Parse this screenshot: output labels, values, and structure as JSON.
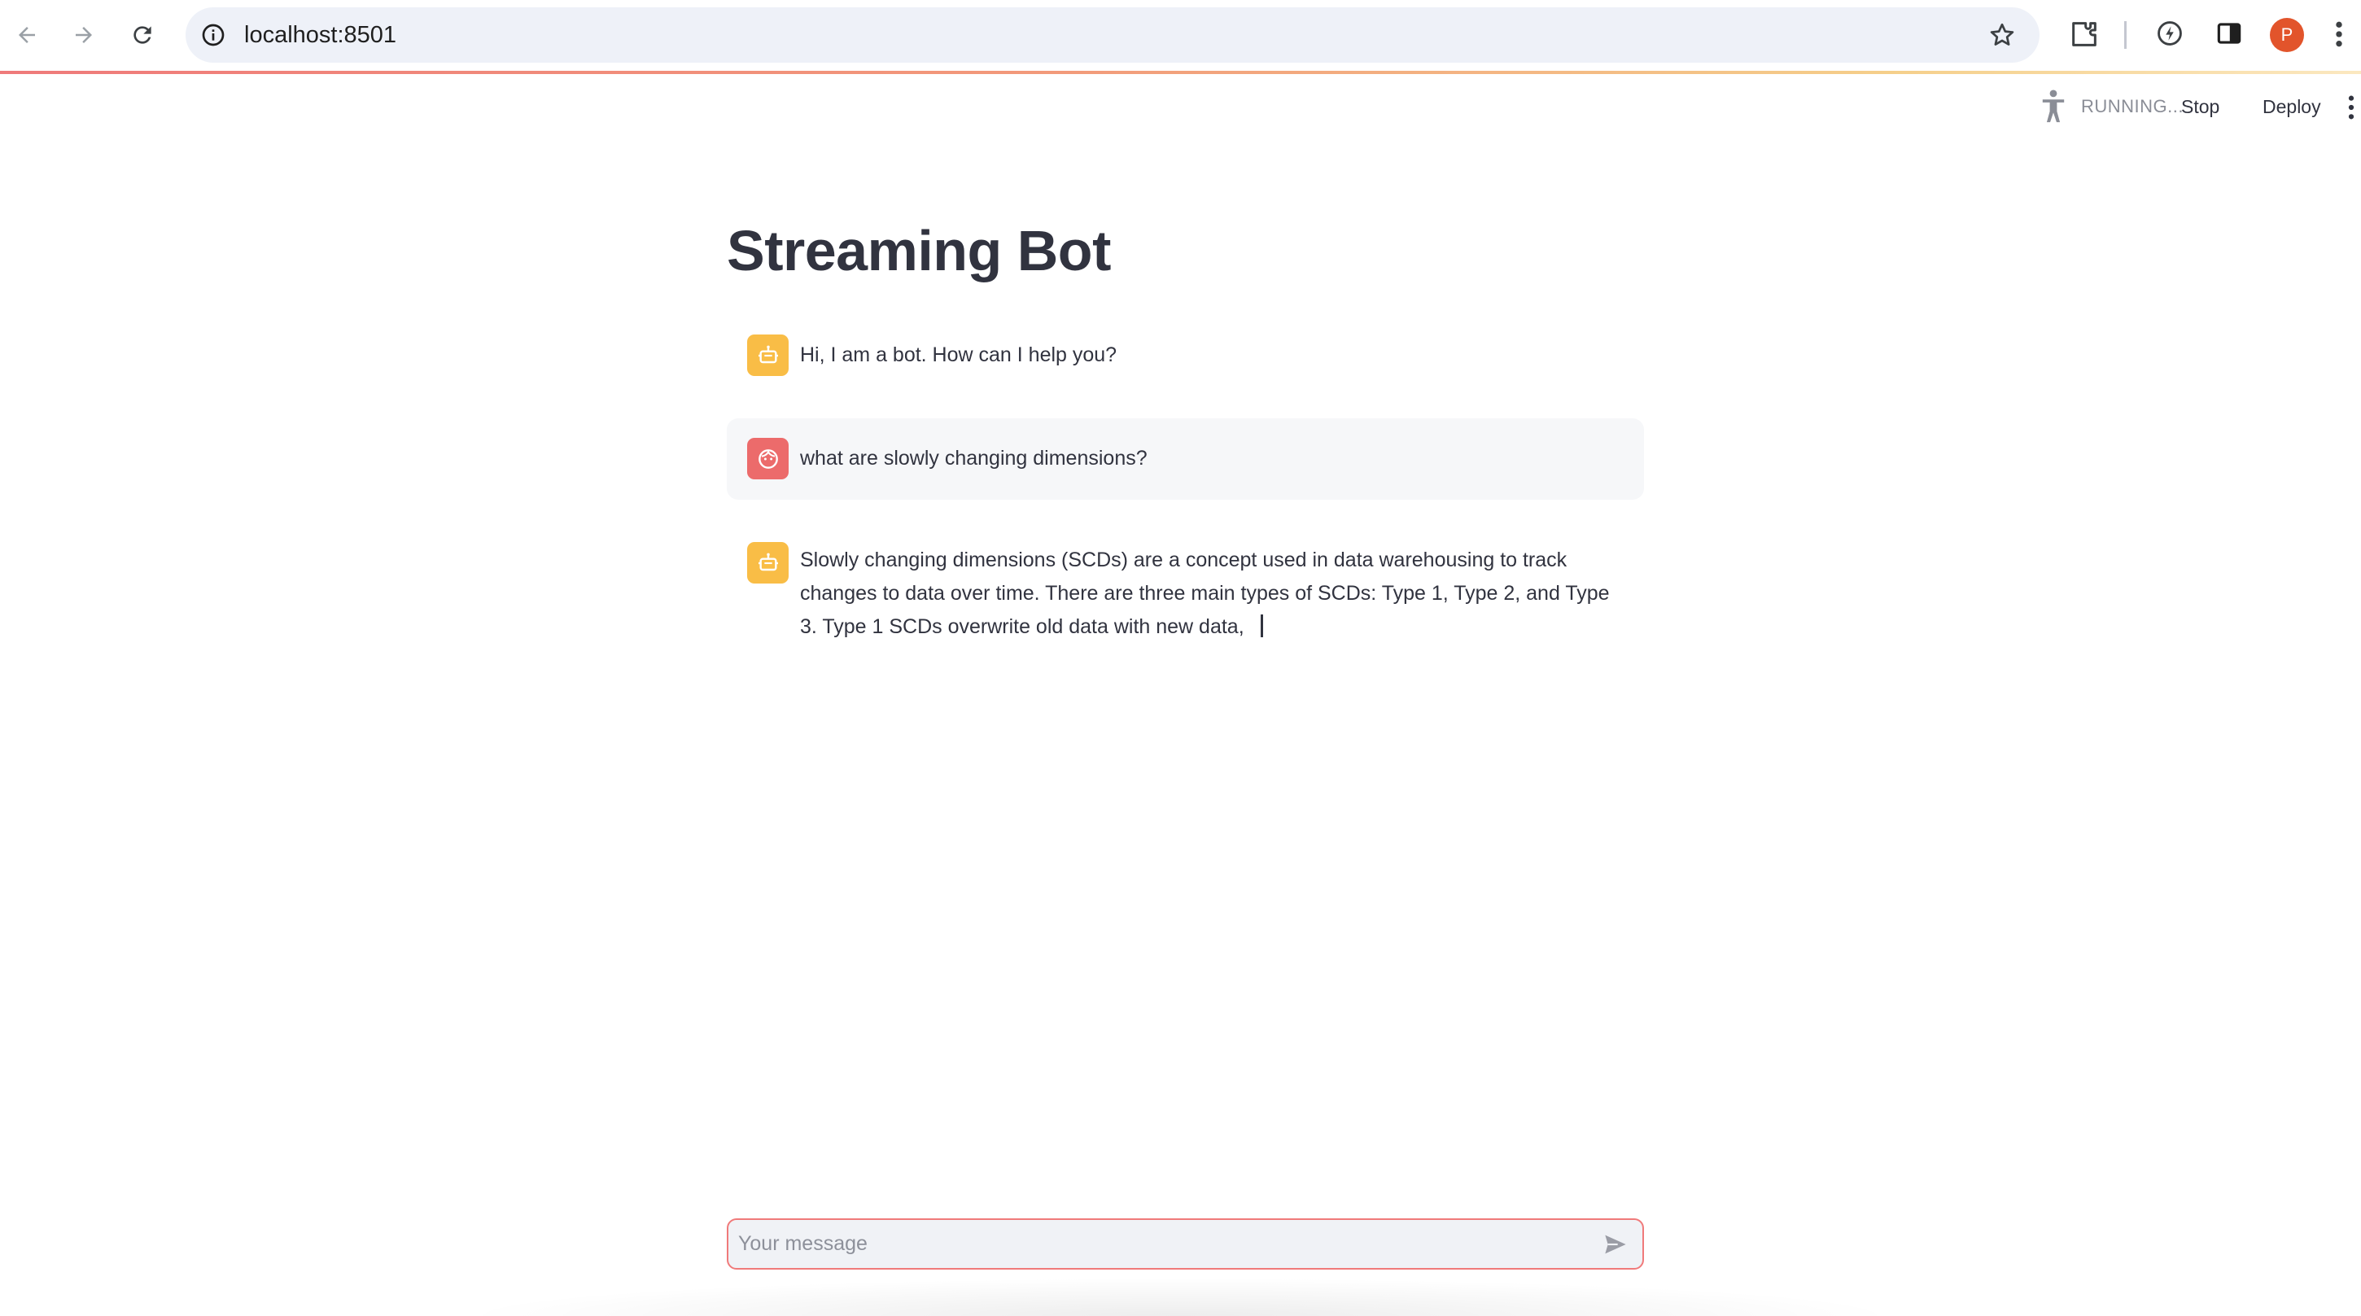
{
  "browser": {
    "url": "localhost:8501",
    "profile_initial": "P",
    "icons": [
      "back-icon",
      "forward-icon",
      "reload-icon",
      "site-info-icon",
      "bookmark-star-icon",
      "extensions-icon",
      "performance-icon",
      "side-panel-icon",
      "menu-icon"
    ]
  },
  "toolbar": {
    "status": "RUNNING...",
    "stop_label": "Stop",
    "deploy_label": "Deploy"
  },
  "page": {
    "title": "Streaming Bot"
  },
  "messages": [
    {
      "role": "assistant",
      "avatar": "bot-icon",
      "text": "Hi, I am a bot. How can I help you?"
    },
    {
      "role": "user",
      "avatar": "user-face-icon",
      "text": "what are slowly changing dimensions?"
    },
    {
      "role": "assistant",
      "avatar": "bot-icon",
      "text": "Slowly changing dimensions (SCDs) are a concept used in data warehousing to track changes to data over time. There are three main types of SCDs: Type 1, Type 2, and Type 3. Type 1 SCDs overwrite old data with new data,"
    }
  ],
  "chat_input": {
    "placeholder": "Your message",
    "value": ""
  },
  "colors": {
    "bot_avatar": "#f9bd46",
    "user_avatar": "#ec6b6b",
    "input_border": "#f07a7a",
    "text": "#31333f"
  }
}
